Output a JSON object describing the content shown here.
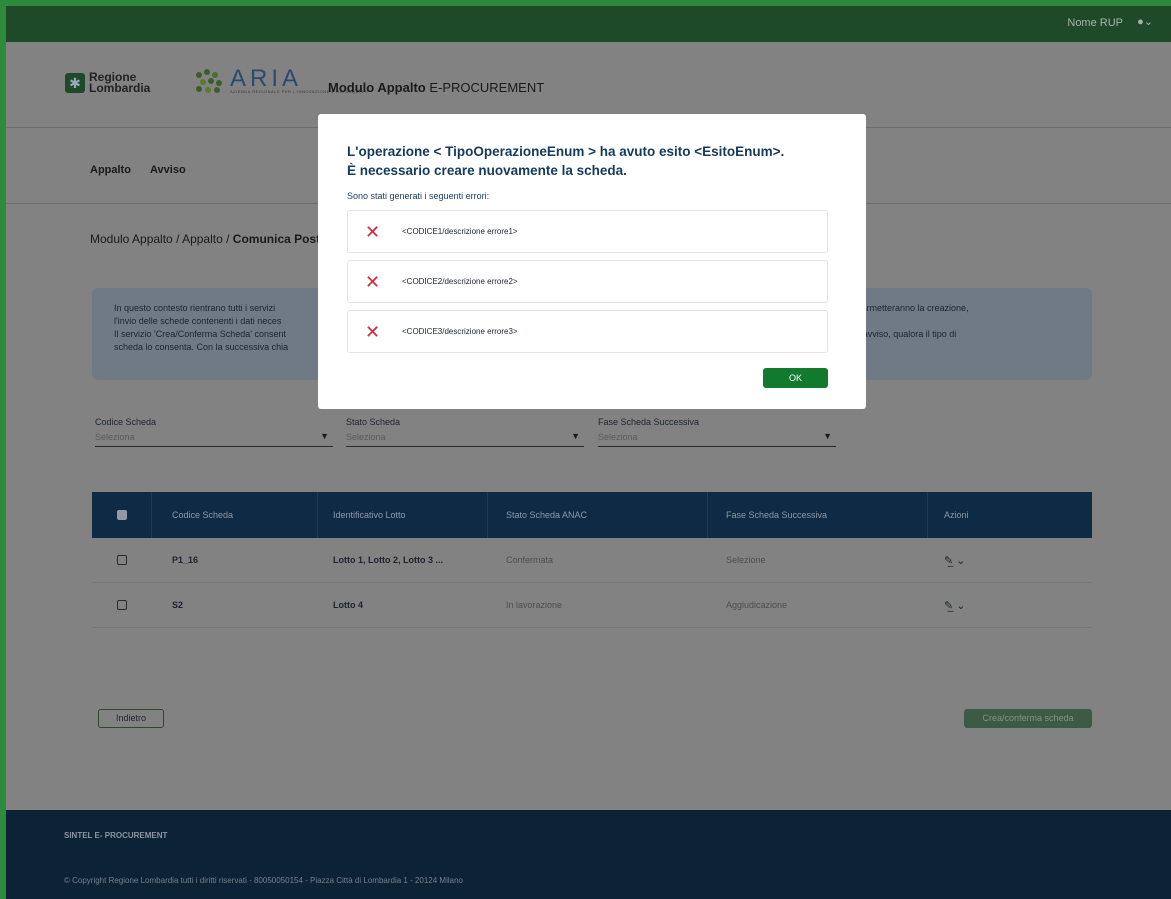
{
  "topbar": {
    "user_name": "Nome RUP",
    "user_icon": "user-icon"
  },
  "header": {
    "logo_rl": "Regione\nLombardia",
    "logo_aria": "ARIA",
    "logo_aria_small": "AZIENDA REGIONALE PER L'INNOVAZIONE E GLI ACQUISTI",
    "app_title_bold": "Modulo Appalto",
    "app_title_rest": " E-PROCUREMENT"
  },
  "tabs": [
    "Appalto",
    "Avviso"
  ],
  "breadcrumb": {
    "path": "Modulo Appalto / Appalto / ",
    "current": "Comunica Post"
  },
  "info_box": {
    "left_lines": [
      "In questo contesto rientrano tutti i servizi",
      "l'invio delle schede contenenti i dati neces",
      "Il servizio 'Crea/Conferma Scheda' consent",
      "scheda lo consenta. Con la successiva chia"
    ],
    "right_lines": [
      "i permetteranno la creazione,",
      "",
      "ell'avviso, qualora il tipo di",
      ""
    ]
  },
  "filters": [
    {
      "label": "Codice Scheda",
      "placeholder": "Seleziona"
    },
    {
      "label": "Stato Scheda",
      "placeholder": "Seleziona"
    },
    {
      "label": "Fase Scheda Successiva",
      "placeholder": "Seleziona"
    }
  ],
  "table": {
    "headers": [
      "Codice Scheda",
      "Identificativo Lotto",
      "Stato Scheda ANAC",
      "Fase Scheda Successiva",
      "Azioni"
    ],
    "rows": [
      {
        "codice": "P1_16",
        "lotto": "Lotto 1, Lotto 2, Lotto 3 ...",
        "stato": "Confermata",
        "fase": "Selezione"
      },
      {
        "codice": "S2",
        "lotto": "Lotto 4",
        "stato": "In lavorazione",
        "fase": "Aggiudicazione"
      }
    ]
  },
  "buttons": {
    "back": "Indietro",
    "create": "Crea/conferma scheda"
  },
  "footer": {
    "title": "SINTEL E- PROCUREMENT",
    "copyright": "© Copyright Regione Lombardia tutti i diritti riservati - 80050050154 - Piazza Città di Lombardia 1 - 20124 Milano"
  },
  "modal": {
    "title_line1": "L'operazione < TipoOperazioneEnum > ha avuto esito <EsitoEnum>.",
    "title_line2": "È necessario creare nuovamente la scheda.",
    "subtitle": "Sono stati generati i seguenti errori:",
    "errors": [
      "<CODICE1/descrizione errore1>",
      "<CODICE2/descrizione errore2>",
      "<CODICE3/descrizione errore3>"
    ],
    "ok_label": "OK"
  },
  "colors": {
    "ok_button": "#127a2e",
    "error_x": "#d6263a",
    "title": "#163a5c"
  }
}
